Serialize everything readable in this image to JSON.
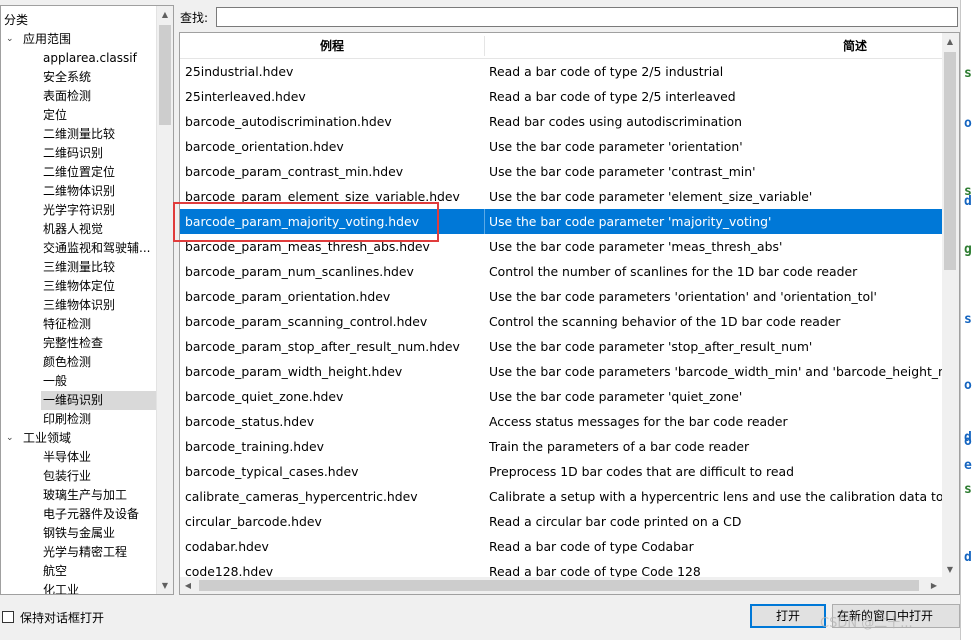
{
  "tree": {
    "header": "分类",
    "items": [
      {
        "label": "应用范围",
        "level": 0,
        "expanded": true
      },
      {
        "label": "applarea.classif",
        "level": 1
      },
      {
        "label": "安全系统",
        "level": 1
      },
      {
        "label": "表面检测",
        "level": 1
      },
      {
        "label": "定位",
        "level": 1
      },
      {
        "label": "二维测量比较",
        "level": 1
      },
      {
        "label": "二维码识别",
        "level": 1
      },
      {
        "label": "二维位置定位",
        "level": 1
      },
      {
        "label": "二维物体识别",
        "level": 1
      },
      {
        "label": "光学字符识别",
        "level": 1
      },
      {
        "label": "机器人视觉",
        "level": 1
      },
      {
        "label": "交通监视和驾驶辅...",
        "level": 1
      },
      {
        "label": "三维测量比较",
        "level": 1
      },
      {
        "label": "三维物体定位",
        "level": 1
      },
      {
        "label": "三维物体识别",
        "level": 1
      },
      {
        "label": "特征检测",
        "level": 1
      },
      {
        "label": "完整性检查",
        "level": 1
      },
      {
        "label": "颜色检测",
        "level": 1
      },
      {
        "label": "一般",
        "level": 1
      },
      {
        "label": "一维码识别",
        "level": 1,
        "selected": true
      },
      {
        "label": "印刷检测",
        "level": 1
      },
      {
        "label": "工业领域",
        "level": 0,
        "expanded": true
      },
      {
        "label": "半导体业",
        "level": 1
      },
      {
        "label": "包装行业",
        "level": 1
      },
      {
        "label": "玻璃生产与加工",
        "level": 1
      },
      {
        "label": "电子元器件及设备",
        "level": 1
      },
      {
        "label": "钢铁与金属业",
        "level": 1
      },
      {
        "label": "光学与精密工程",
        "level": 1
      },
      {
        "label": "航空",
        "level": 1
      },
      {
        "label": "化工业",
        "level": 1
      }
    ]
  },
  "search": {
    "label": "查找:",
    "value": ""
  },
  "table": {
    "columns": [
      "例程",
      "简述"
    ],
    "selected_index": 7,
    "rows": [
      [
        "25industrial.hdev",
        "Read a bar code of type 2/5 industrial"
      ],
      [
        "25interleaved.hdev",
        "Read a bar code of type 2/5 interleaved"
      ],
      [
        "barcode_autodiscrimination.hdev",
        "Read bar codes using autodiscrimination"
      ],
      [
        "barcode_orientation.hdev",
        "Use the bar code parameter 'orientation'"
      ],
      [
        "barcode_param_contrast_min.hdev",
        "Use the bar code parameter 'contrast_min'"
      ],
      [
        "barcode_param_element_size_variable.hdev",
        "Use the bar code parameter 'element_size_variable'"
      ],
      [
        "barcode_param_majority_voting.hdev",
        "Use the bar code parameter 'majority_voting'"
      ],
      [
        "barcode_param_meas_thresh_abs.hdev",
        "Use the bar code parameter 'meas_thresh_abs'"
      ],
      [
        "barcode_param_num_scanlines.hdev",
        "Control the number of scanlines for the 1D bar code reader"
      ],
      [
        "barcode_param_orientation.hdev",
        "Use the bar code parameters 'orientation' and 'orientation_tol'"
      ],
      [
        "barcode_param_scanning_control.hdev",
        "Control the scanning behavior of the 1D bar code reader"
      ],
      [
        "barcode_param_stop_after_result_num.hdev",
        "Use the bar code parameter 'stop_after_result_num'"
      ],
      [
        "barcode_param_width_height.hdev",
        "Use the bar code parameters 'barcode_width_min' and 'barcode_height_min'"
      ],
      [
        "barcode_quiet_zone.hdev",
        "Use the bar code parameter 'quiet_zone'"
      ],
      [
        "barcode_status.hdev",
        "Access status messages for the bar code reader"
      ],
      [
        "barcode_training.hdev",
        "Train the parameters of a bar code reader"
      ],
      [
        "barcode_typical_cases.hdev",
        "Preprocess 1D bar codes that are difficult to read"
      ],
      [
        "calibrate_cameras_hypercentric.hdev",
        "Calibrate a setup with a hypercentric lens and use the calibration data to unro"
      ],
      [
        "circular_barcode.hdev",
        "Read a circular bar code printed on a CD"
      ],
      [
        "codabar.hdev",
        "Read a bar code of type Codabar"
      ],
      [
        "code128.hdev",
        "Read a bar code of type Code 128"
      ]
    ]
  },
  "footer": {
    "keep_open_label": "保持对话框打开",
    "open_label": "打开",
    "open_new_label": "在新的窗口中打开",
    "watermark": "CSDN @二十..."
  },
  "background_strip": [
    "s",
    "o",
    "s",
    "d",
    "g",
    "s",
    "o",
    "d",
    "o",
    "e",
    "s",
    "d"
  ],
  "colors": {
    "selection": "#0078d7",
    "highlight_box": "#e03c3c"
  }
}
